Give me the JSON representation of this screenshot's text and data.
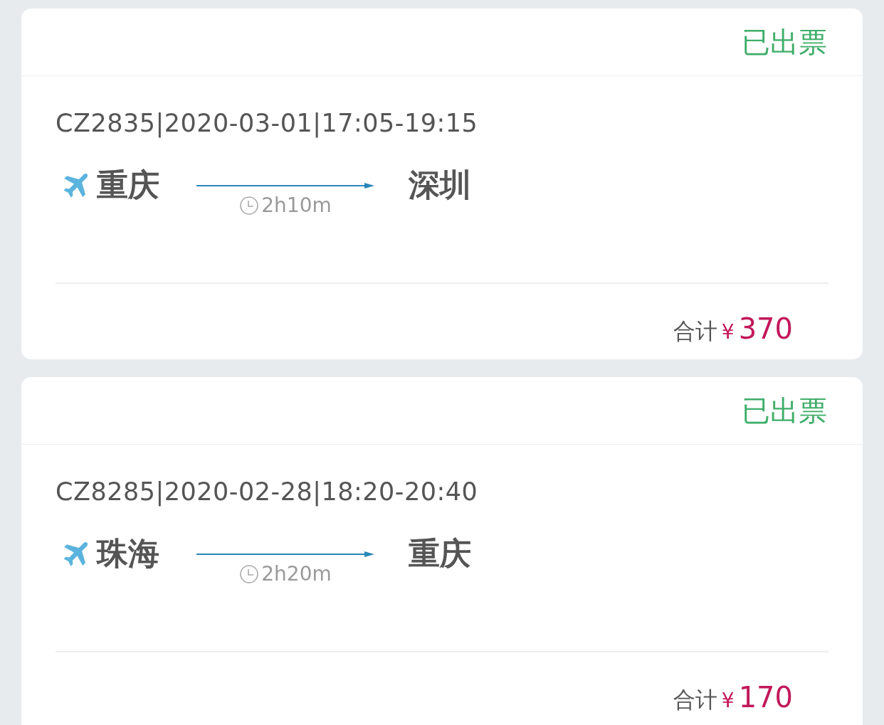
{
  "orders": [
    {
      "status": "已出票",
      "flight": "CZ2835|2020-03-01|17:05-19:15",
      "from": "重庆",
      "to": "深圳",
      "duration": "2h10m",
      "total_label": "合计",
      "currency": "¥",
      "amount": "370"
    },
    {
      "status": "已出票",
      "flight": "CZ8285|2020-02-28|18:20-20:40",
      "from": "珠海",
      "to": "重庆",
      "duration": "2h20m",
      "total_label": "合计",
      "currency": "¥",
      "amount": "170"
    }
  ]
}
